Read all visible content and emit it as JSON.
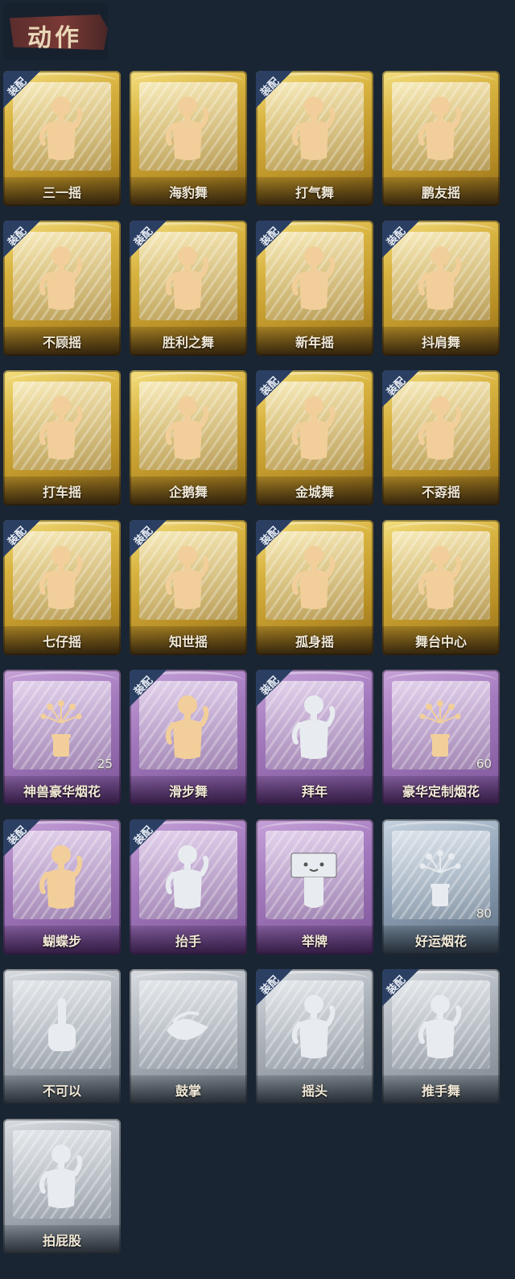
{
  "header": {
    "title": "动作"
  },
  "badge_label": "装配",
  "colors": {
    "gold": "#d9b441",
    "purple": "#a379bd",
    "blue": "#8fa2b6",
    "gray": "#a7aeb6",
    "icon_gold": "#f2cf9a",
    "icon_white": "#e8ecf0"
  },
  "cards": [
    {
      "label": "三一摇",
      "rarity": "gold",
      "equipped": true,
      "icon": "dancer-figure-icon"
    },
    {
      "label": "海豹舞",
      "rarity": "gold",
      "equipped": false,
      "icon": "dancer-figure-icon"
    },
    {
      "label": "打气舞",
      "rarity": "gold",
      "equipped": true,
      "icon": "dancer-figure-icon"
    },
    {
      "label": "鹏友摇",
      "rarity": "gold",
      "equipped": false,
      "icon": "dancer-figure-icon"
    },
    {
      "label": "不顾摇",
      "rarity": "gold",
      "equipped": true,
      "icon": "dancer-figure-icon"
    },
    {
      "label": "胜利之舞",
      "rarity": "gold",
      "equipped": true,
      "icon": "dancer-figure-icon"
    },
    {
      "label": "新年摇",
      "rarity": "gold",
      "equipped": true,
      "icon": "dancer-figure-icon"
    },
    {
      "label": "抖肩舞",
      "rarity": "gold",
      "equipped": true,
      "icon": "dancer-figure-icon"
    },
    {
      "label": "打车摇",
      "rarity": "gold",
      "equipped": false,
      "icon": "dancer-figure-icon"
    },
    {
      "label": "企鹅舞",
      "rarity": "gold",
      "equipped": false,
      "icon": "dancer-figure-icon"
    },
    {
      "label": "金城舞",
      "rarity": "gold",
      "equipped": true,
      "icon": "dancer-figure-icon"
    },
    {
      "label": "不孬摇",
      "rarity": "gold",
      "equipped": true,
      "icon": "dancer-figure-icon"
    },
    {
      "label": "七仔摇",
      "rarity": "gold",
      "equipped": true,
      "icon": "dancer-figure-icon"
    },
    {
      "label": "知世摇",
      "rarity": "gold",
      "equipped": true,
      "icon": "dancer-figure-icon"
    },
    {
      "label": "孤身摇",
      "rarity": "gold",
      "equipped": true,
      "icon": "dancer-figure-icon"
    },
    {
      "label": "舞台中心",
      "rarity": "gold",
      "equipped": false,
      "icon": "dancer-figure-icon"
    },
    {
      "label": "神兽豪华烟花",
      "rarity": "purple",
      "equipped": false,
      "icon": "firework-icon",
      "count": "25"
    },
    {
      "label": "滑步舞",
      "rarity": "purple",
      "equipped": true,
      "icon": "dancer-figure-icon"
    },
    {
      "label": "拜年",
      "rarity": "purple",
      "equipped": true,
      "icon": "dancer-figure-icon",
      "icon_tone": "white"
    },
    {
      "label": "豪华定制烟花",
      "rarity": "purple",
      "equipped": false,
      "icon": "firework-icon",
      "count": "60"
    },
    {
      "label": "蝴蝶步",
      "rarity": "purple",
      "equipped": true,
      "icon": "dancer-figure-icon"
    },
    {
      "label": "抬手",
      "rarity": "purple",
      "equipped": true,
      "icon": "dancer-figure-icon",
      "icon_tone": "white"
    },
    {
      "label": "举牌",
      "rarity": "purple",
      "equipped": false,
      "icon": "sign-holder-icon",
      "icon_tone": "white"
    },
    {
      "label": "好运烟花",
      "rarity": "blue",
      "equipped": false,
      "icon": "firework-icon",
      "icon_tone": "white",
      "count": "80"
    },
    {
      "label": "不可以",
      "rarity": "gray",
      "equipped": false,
      "icon": "pointing-hand-icon",
      "icon_tone": "white"
    },
    {
      "label": "鼓掌",
      "rarity": "gray",
      "equipped": false,
      "icon": "clapping-hands-icon",
      "icon_tone": "white"
    },
    {
      "label": "摇头",
      "rarity": "gray",
      "equipped": true,
      "icon": "dancer-figure-icon",
      "icon_tone": "white"
    },
    {
      "label": "推手舞",
      "rarity": "gray",
      "equipped": true,
      "icon": "dancer-figure-icon",
      "icon_tone": "white"
    },
    {
      "label": "拍屁股",
      "rarity": "gray",
      "equipped": false,
      "icon": "dancer-figure-icon",
      "icon_tone": "white"
    }
  ]
}
